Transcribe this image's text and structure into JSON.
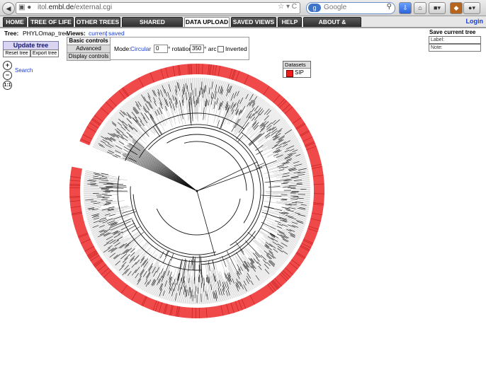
{
  "browser": {
    "url_prefix": "itol.",
    "url_domain": "embl.de",
    "url_path": "/external.cgi",
    "search_placeholder": "Google",
    "search_engine_label": "g"
  },
  "site_tabs": [
    "HOME",
    "TREE OF LIFE",
    "OTHER TREES",
    "SHARED PROJECTS",
    "DATA UPLOAD",
    "SAVED VIEWS",
    "HELP",
    "ABOUT & CONTACT"
  ],
  "active_tab": "DATA UPLOAD",
  "login_label": "Login",
  "tree": {
    "label": "Tree:",
    "name": "PHYLOmap_tree"
  },
  "views": {
    "label": "Views:",
    "current": "current",
    "separator": "|",
    "saved": "saved"
  },
  "buttons": {
    "update_tree": "Update tree",
    "reset_tree": "Reset tree",
    "export_tree": "Export tree"
  },
  "control_tabs": [
    "Basic controls",
    "Advanced controls",
    "Display controls"
  ],
  "mode": {
    "label": "Mode:",
    "value": "Circular",
    "start_angle": "0",
    "rotation_label": "° rotation",
    "arc": "350",
    "arc_label": "° arc",
    "inverted_label": "Inverted",
    "inverted": false
  },
  "search_label": "Search",
  "zoom_icons": [
    "zoom-in-icon",
    "zoom-out-icon",
    "zoom-reset-icon"
  ],
  "save_view": {
    "title": "Save current tree view",
    "label_placeholder": "Label:",
    "note_placeholder": "Note:"
  },
  "datasets": {
    "title": "Datasets",
    "items": [
      {
        "name": "SIP",
        "color": "#ee1c1c"
      }
    ]
  },
  "colors": {
    "tab_dark": "#2e2e2e",
    "link": "#1a3ccc",
    "dataset_ring": "#f0494a",
    "branch": "#111111"
  }
}
